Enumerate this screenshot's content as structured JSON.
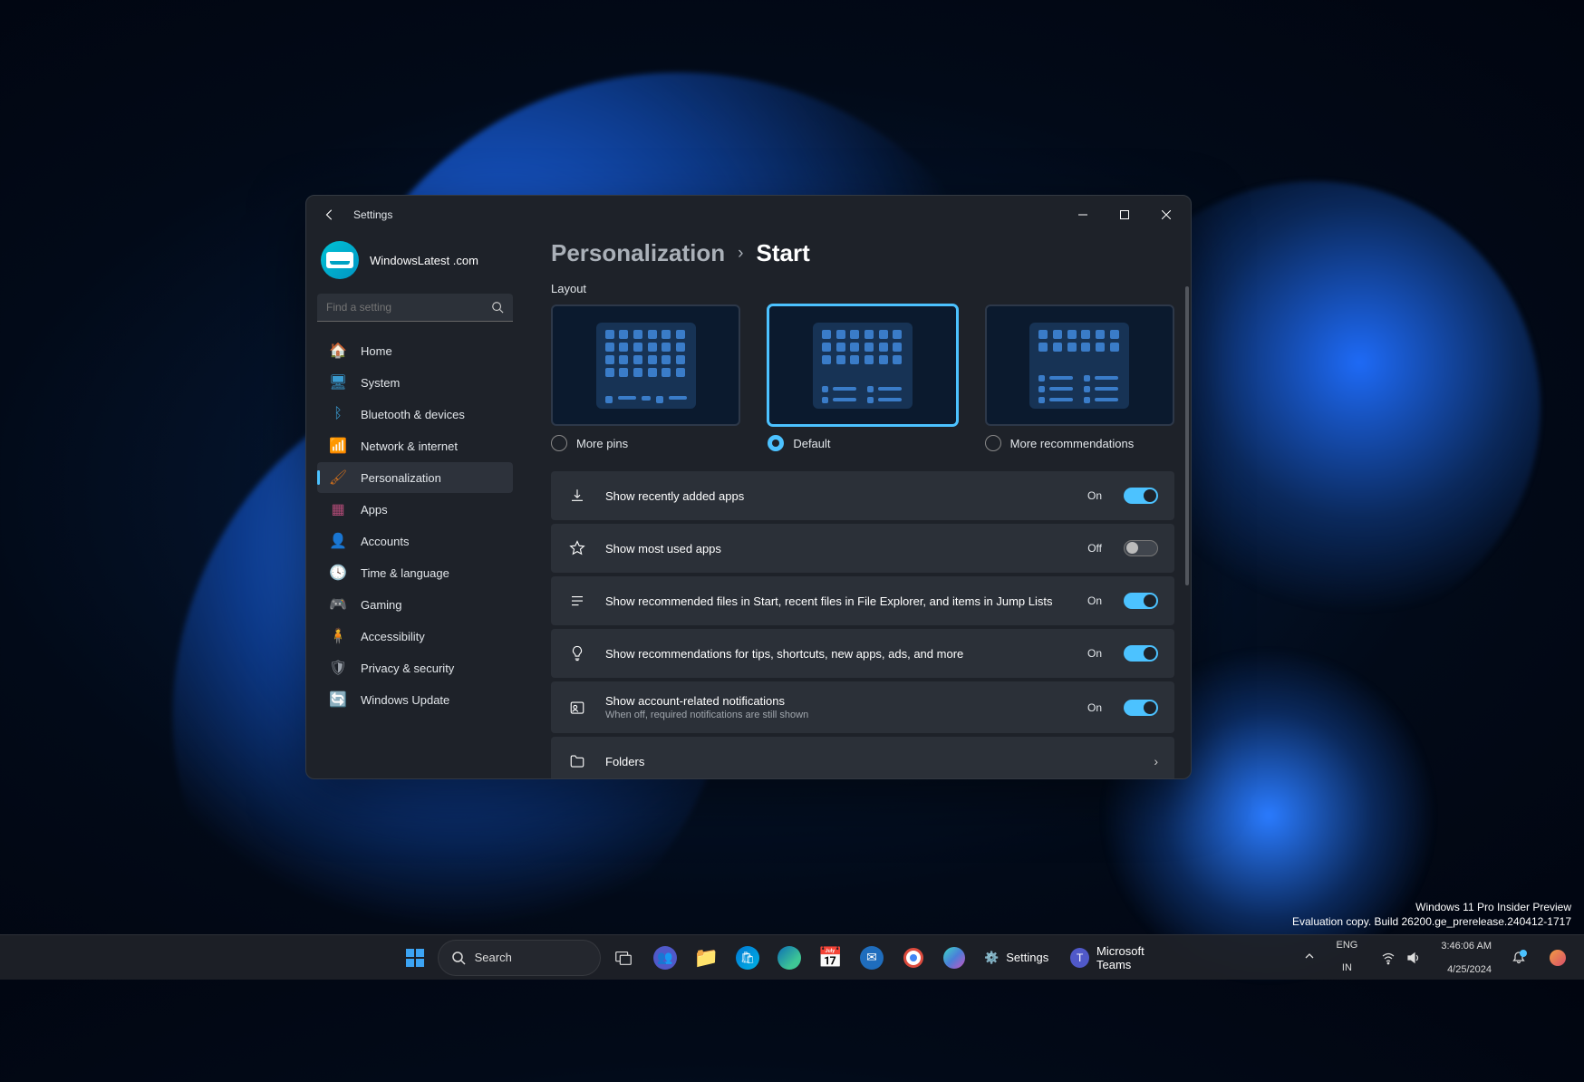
{
  "window": {
    "title": "Settings"
  },
  "profile": {
    "name": "WindowsLatest .com"
  },
  "search": {
    "placeholder": "Find a setting"
  },
  "nav": [
    {
      "label": "Home",
      "icon": "🏠",
      "color": "#c56b1e"
    },
    {
      "label": "System",
      "icon": "💻",
      "color": "#3a9bd0"
    },
    {
      "label": "Bluetooth & devices",
      "icon": "🖱",
      "color": "#3a9bd0"
    },
    {
      "label": "Network & internet",
      "icon": "📶",
      "color": "#3a9bd0"
    },
    {
      "label": "Personalization",
      "icon": "🖌",
      "color": "#c56b1e"
    },
    {
      "label": "Apps",
      "icon": "▦",
      "color": "#b44c78"
    },
    {
      "label": "Accounts",
      "icon": "👤",
      "color": "#2cc38a"
    },
    {
      "label": "Time & language",
      "icon": "🕓",
      "color": "#a78b5a"
    },
    {
      "label": "Gaming",
      "icon": "🎮",
      "color": "#3a9bd0"
    },
    {
      "label": "Accessibility",
      "icon": "♿",
      "color": "#3a9bd0"
    },
    {
      "label": "Privacy & security",
      "icon": "🛡",
      "color": "#9aa1a9"
    },
    {
      "label": "Windows Update",
      "icon": "🔄",
      "color": "#3a9bd0"
    }
  ],
  "breadcrumb": {
    "parent": "Personalization",
    "current": "Start"
  },
  "layout_section": {
    "label": "Layout",
    "options": [
      {
        "label": "More pins",
        "selected": false
      },
      {
        "label": "Default",
        "selected": true
      },
      {
        "label": "More recommendations",
        "selected": false
      }
    ]
  },
  "settings": [
    {
      "icon": "download",
      "title": "Show recently added apps",
      "state": "On",
      "on": true
    },
    {
      "icon": "star",
      "title": "Show most used apps",
      "state": "Off",
      "on": false
    },
    {
      "icon": "list",
      "title": "Show recommended files in Start, recent files in File Explorer, and items in Jump Lists",
      "state": "On",
      "on": true
    },
    {
      "icon": "bulb",
      "title": "Show recommendations for tips, shortcuts, new apps, ads, and more",
      "state": "On",
      "on": true
    },
    {
      "icon": "account",
      "title": "Show account-related notifications",
      "sub": "When off, required notifications are still shown",
      "state": "On",
      "on": true
    },
    {
      "icon": "folder",
      "title": "Folders",
      "nav": true
    }
  ],
  "taskbar": {
    "search_label": "Search",
    "apps": [
      {
        "name": "settings",
        "label": "Settings"
      },
      {
        "name": "teams",
        "label": "Microsoft Teams"
      }
    ]
  },
  "systray": {
    "lang1": "ENG",
    "lang2": "IN",
    "time": "3:46:06 AM",
    "date": "4/25/2024"
  },
  "insider": {
    "line1": "Windows 11 Pro Insider Preview",
    "line2": "Evaluation copy. Build 26200.ge_prerelease.240412-1717"
  }
}
